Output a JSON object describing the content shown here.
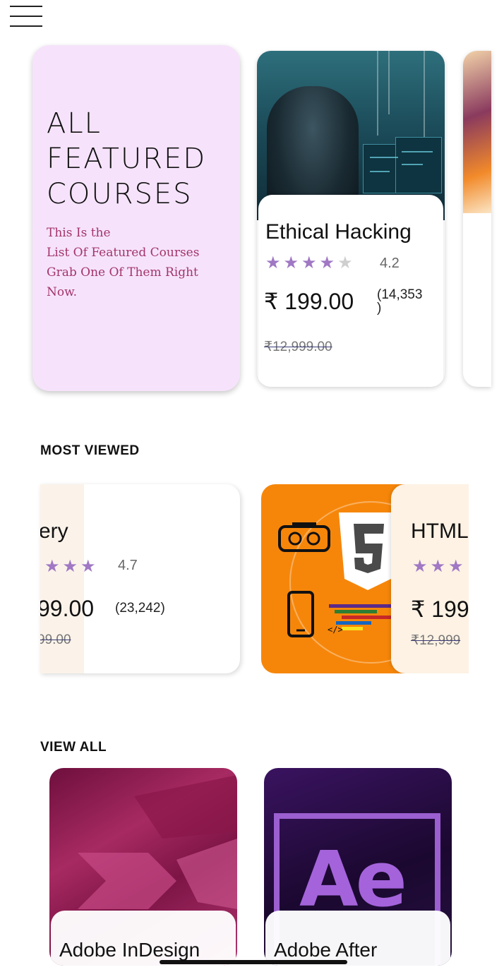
{
  "menu": {
    "icon": "hamburger-menu-icon"
  },
  "featured": {
    "title_lines": [
      "All",
      "Featured",
      "Courses"
    ],
    "subtitle_lines": [
      "This Is the",
      " List Of Featured Courses",
      "Grab One Of Them Right",
      "Now."
    ]
  },
  "featured_courses": [
    {
      "title": "Ethical Hacking",
      "rating": "4.2",
      "rating_value": 4.2,
      "price": "₹ 199.00",
      "reviews": "(14,353",
      "reviews_close": ")",
      "old_price": "₹12,999.00"
    }
  ],
  "sections": {
    "most_viewed": "MOST VIEWED",
    "view_all": "VIEW ALL"
  },
  "most_viewed": [
    {
      "title_partial": "ery",
      "rating": "4.7",
      "rating_value": 4.7,
      "price_partial": "99.00",
      "reviews": "(23,242)",
      "old_price_partial": "99.00"
    },
    {
      "title_partial": "HTML",
      "price_partial": "₹ 199",
      "old_price_partial": "₹12,999"
    }
  ],
  "view_all": [
    {
      "title": "Adobe InDesign"
    },
    {
      "title": "Adobe After",
      "image_text": "Ae"
    }
  ],
  "colors": {
    "accent_star": "#a078c4",
    "featured_bg": "#f6e3fb",
    "featured_subtitle": "#a3346b",
    "html_card_bg": "#f6860a"
  }
}
